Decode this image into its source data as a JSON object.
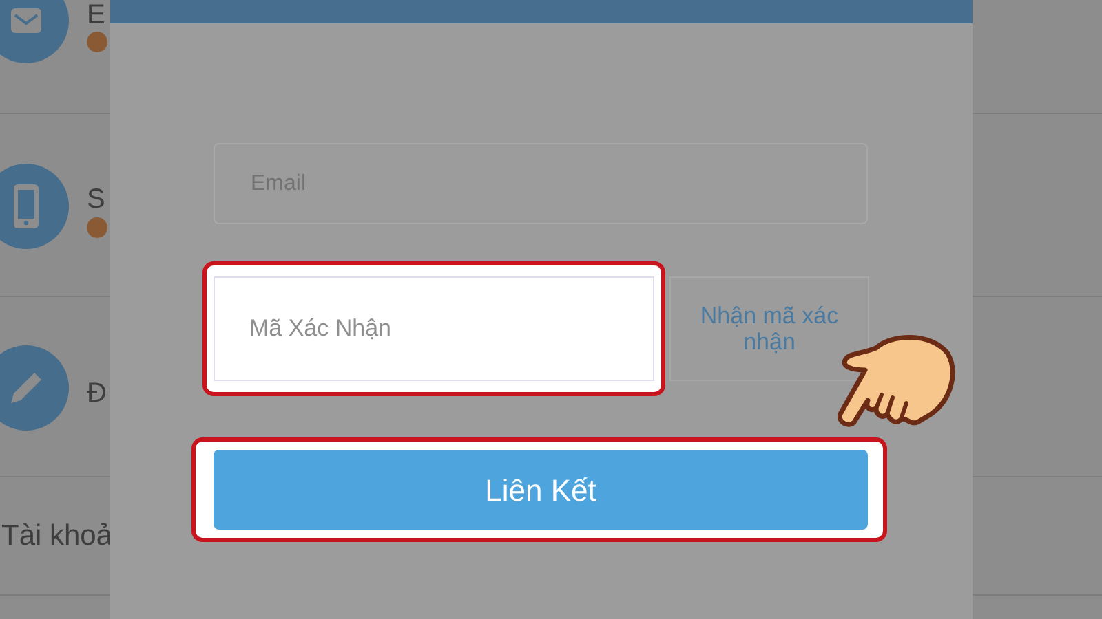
{
  "background_list": {
    "items": [
      {
        "label": "E",
        "warning": true
      },
      {
        "label": "S",
        "warning": true
      },
      {
        "label": "Đ",
        "warning": false
      }
    ],
    "section_title": "Tài khoả"
  },
  "dialog": {
    "email_field": {
      "placeholder": "Email"
    },
    "code_field": {
      "placeholder": "Mã Xác Nhận",
      "highlighted": true
    },
    "get_code_button": "Nhận mã xác nhận",
    "link_button": {
      "label": "Liên Kết",
      "highlighted": true
    }
  }
}
